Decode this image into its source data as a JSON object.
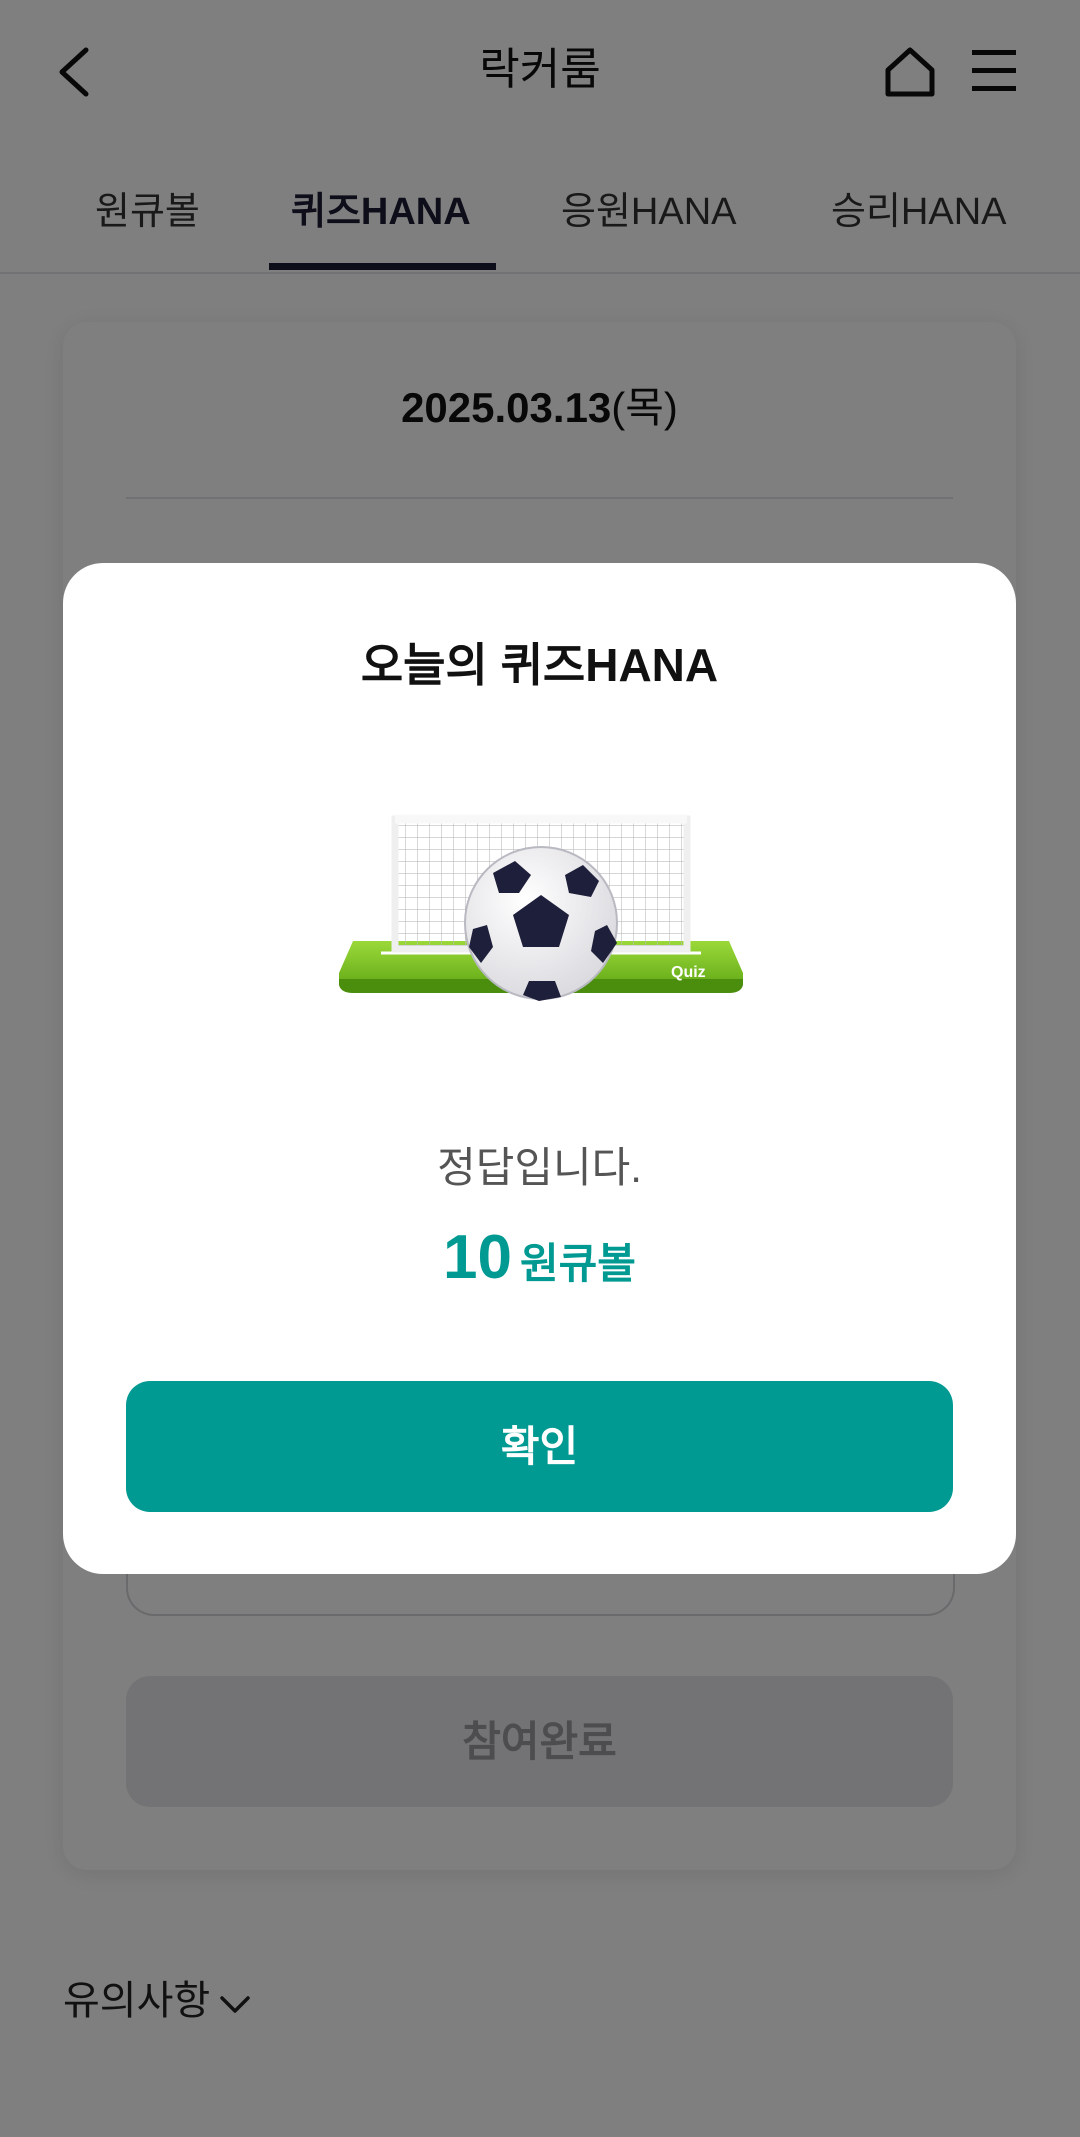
{
  "header": {
    "title": "락커룸",
    "back_icon": "chevron-left-icon",
    "home_icon": "home-icon",
    "menu_icon": "hamburger-menu-icon"
  },
  "tabs": [
    {
      "label": "원큐볼",
      "active": false
    },
    {
      "label": "퀴즈HANA",
      "active": true
    },
    {
      "label": "응원HANA",
      "active": false
    },
    {
      "label": "승리HANA",
      "active": false
    }
  ],
  "card": {
    "date": "2025.03.13",
    "weekday": "(목)",
    "participated_label": "참여완료"
  },
  "notice": {
    "label": "유의사항",
    "icon": "chevron-down-icon"
  },
  "modal": {
    "title": "오늘의 퀴즈HANA",
    "illustration": {
      "icon": "soccer-goal-ball-illustration",
      "badge_text": "Quiz"
    },
    "message": "정답입니다.",
    "reward_amount": "10",
    "reward_unit": "원큐볼",
    "confirm_label": "확인"
  },
  "colors": {
    "accent": "#009a92",
    "tab_active": "#1b1d33",
    "overlay": "rgba(0,0,0,0.5)",
    "field_green": "#7cc51e"
  }
}
